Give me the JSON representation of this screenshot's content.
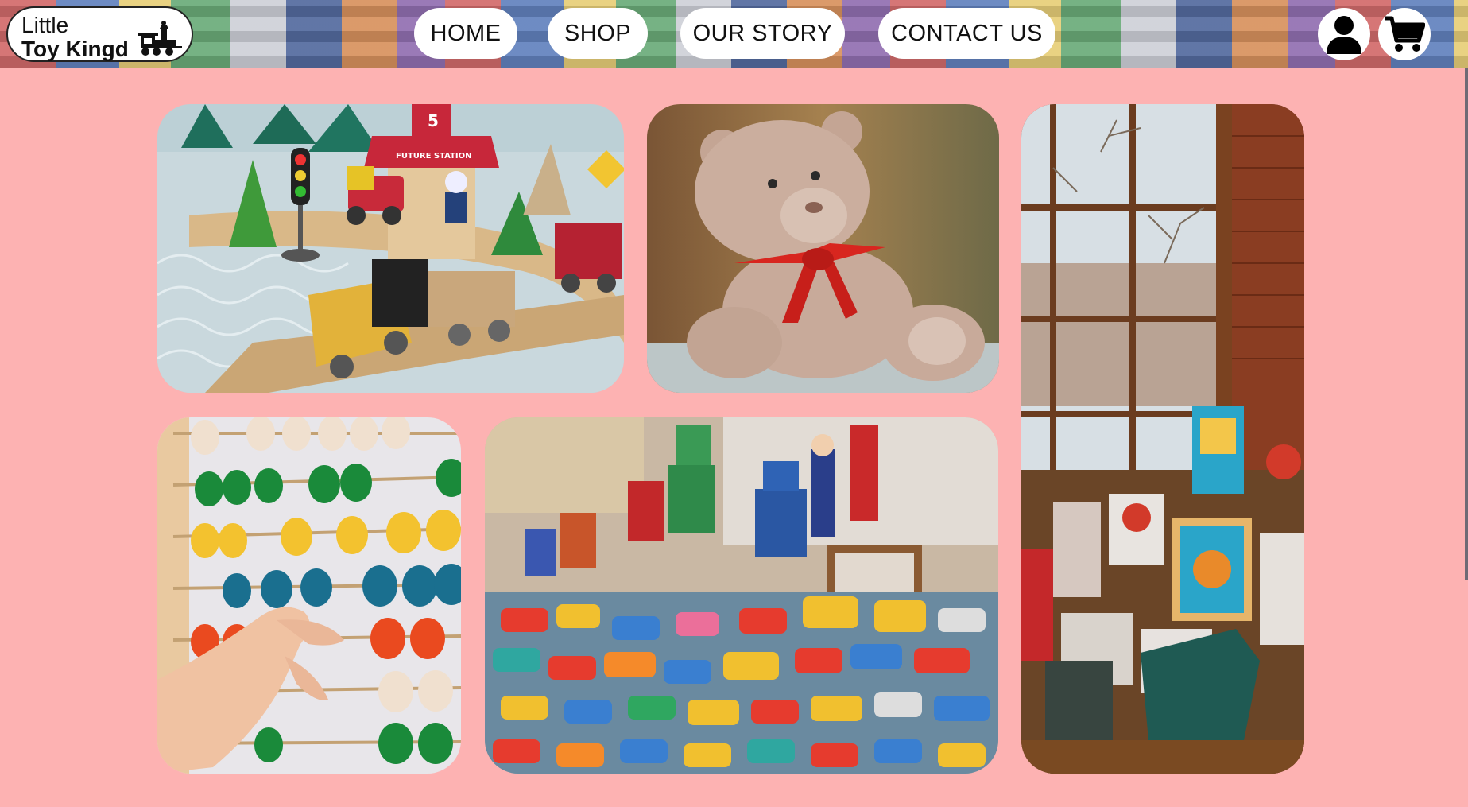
{
  "logo": {
    "line1": "Little",
    "line2": "Toy Kingd"
  },
  "nav": {
    "items": [
      {
        "label": "HOME"
      },
      {
        "label": "SHOP"
      },
      {
        "label": "OUR STORY"
      },
      {
        "label": "CONTACT US"
      }
    ]
  },
  "header_icons": {
    "account": "user-icon",
    "cart": "shopping-cart-icon"
  },
  "gallery": {
    "tiles": [
      {
        "subject": "wooden toy train set"
      },
      {
        "subject": "teddy bear with red bow"
      },
      {
        "subject": "toy store window display"
      },
      {
        "subject": "colorful bead abacus"
      },
      {
        "subject": "vintage toy robots and cars"
      }
    ],
    "signs": {
      "station": "FUTURE STATION",
      "station_number": "5"
    }
  },
  "colors": {
    "page_bg": "#fdb2b2",
    "pill_bg": "#ffffff",
    "text": "#111111"
  }
}
